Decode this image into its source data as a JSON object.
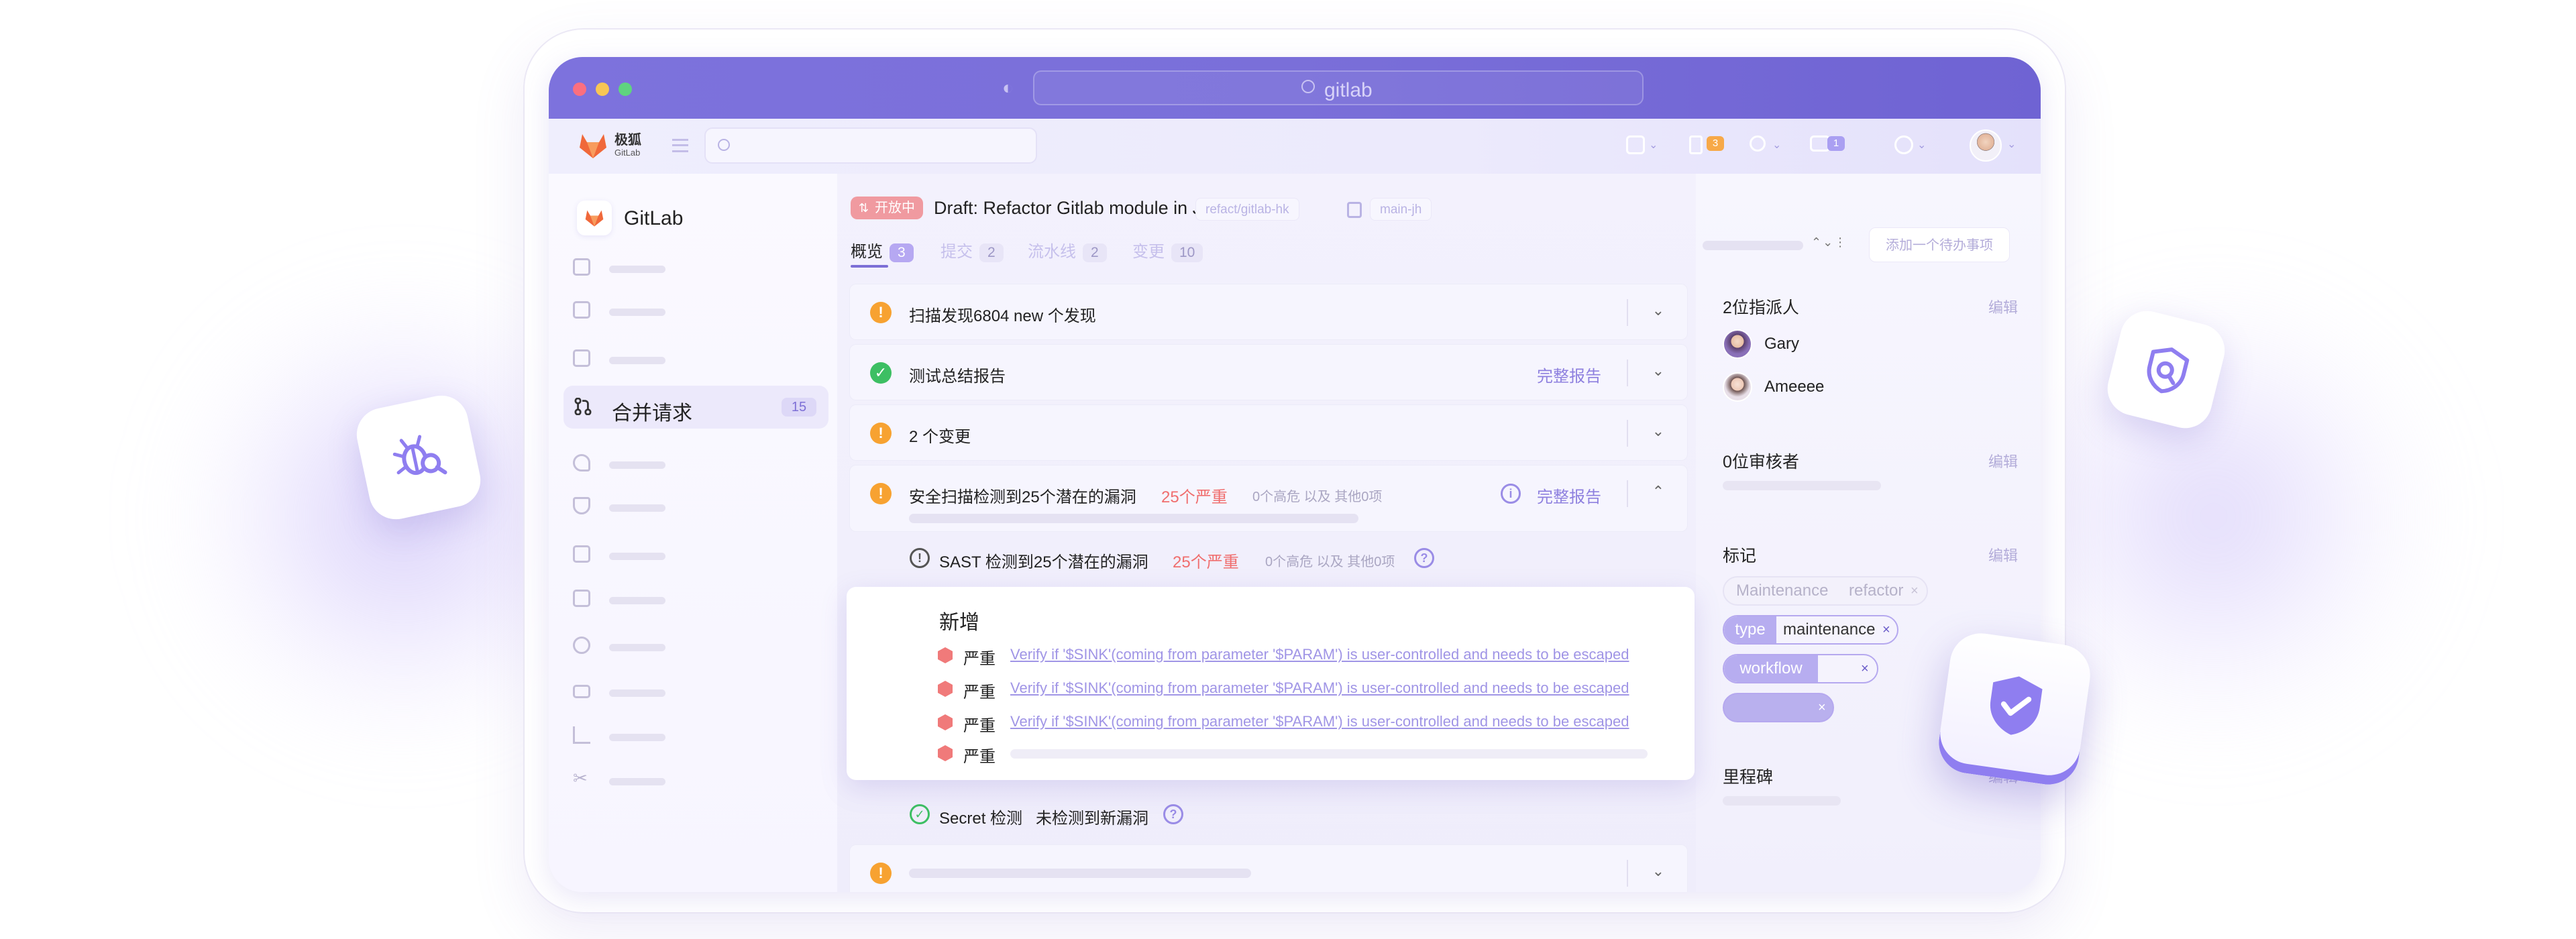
{
  "browser": {
    "url": "gitlab"
  },
  "app": {
    "brand_cn": "极狐",
    "brand_en": "GitLab",
    "header_badges": [
      {
        "name": "issues",
        "count": "3",
        "color": "#f7a948"
      },
      {
        "name": "todos",
        "count": "1",
        "color": "#aa9ff2"
      }
    ]
  },
  "sidebar": {
    "title": "GitLab",
    "active_item": {
      "label": "合并请求",
      "count": "15"
    }
  },
  "merge_request": {
    "status": "开放中",
    "title": "Draft: Refactor Gitlab module in JH",
    "source_branch": "refact/gitlab-hk",
    "target_branch": "main-jh",
    "tabs": [
      {
        "label": "概览",
        "count": "3",
        "active": true
      },
      {
        "label": "提交",
        "count": "2",
        "active": false
      },
      {
        "label": "流水线",
        "count": "2",
        "active": false
      },
      {
        "label": "变更",
        "count": "10",
        "active": false
      }
    ]
  },
  "widgets": {
    "scan": {
      "text": "扫描发现6804 new 个发现"
    },
    "test": {
      "text": "测试总结报告",
      "link": "完整报告"
    },
    "changes": {
      "text": "2 个变更"
    },
    "security": {
      "text": "安全扫描检测到25个潜在的漏洞",
      "severity": "25个严重",
      "meta": "0个高危 以及 其他0项",
      "link": "完整报告"
    },
    "sast": {
      "text": "SAST 检测到25个潜在的漏洞",
      "severity": "25个严重",
      "meta": "0个高危 以及 其他0项"
    },
    "new_findings": {
      "title": "新增",
      "items": [
        {
          "severity": "严重",
          "text": "Verify if '$SINK'(coming from parameter '$PARAM') is user-controlled and needs to be escaped"
        },
        {
          "severity": "严重",
          "text": "Verify if '$SINK'(coming from parameter '$PARAM') is user-controlled and needs to be escaped"
        },
        {
          "severity": "严重",
          "text": "Verify if '$SINK'(coming from parameter '$PARAM') is user-controlled and needs to be escaped"
        },
        {
          "severity": "严重",
          "text": ""
        }
      ]
    },
    "secret": {
      "label": "Secret 检测",
      "text": "未检测到新漏洞"
    }
  },
  "right_panel": {
    "todo_button": "添加一个待办事项",
    "assignees": {
      "title": "2位指派人",
      "edit": "编辑",
      "people": [
        {
          "name": "Gary"
        },
        {
          "name": "Ameeee"
        }
      ]
    },
    "reviewers": {
      "title": "0位审核者",
      "edit": "编辑"
    },
    "labels": {
      "title": "标记",
      "edit": "编辑",
      "items": [
        {
          "key": "Maintenance",
          "value": "refactor"
        },
        {
          "key": "type",
          "value": "maintenance"
        },
        {
          "key": "workflow",
          "value": ""
        },
        {
          "key": "",
          "value": ""
        }
      ]
    },
    "milestone": {
      "title": "里程碑",
      "edit": "编辑"
    }
  },
  "colors": {
    "accent": "#7d6fd6",
    "titlebar": "#7a6fd9",
    "warning": "#f7a231",
    "success": "#3dbf63",
    "danger": "#f06e6e"
  },
  "icons": [
    "bug-icon",
    "search-shield-icon",
    "shield-check-icon",
    "gitlab-fox-icon",
    "merge-request-icon"
  ]
}
